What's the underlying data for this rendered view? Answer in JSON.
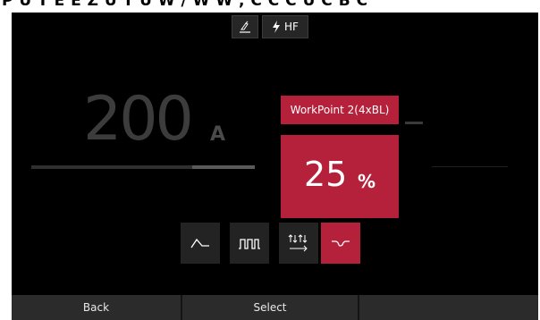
{
  "banner": {
    "text": "P U T E   E  Z U T U   W / W W ,  C C C  U C B C"
  },
  "mode_bar": {
    "torch_icon": "torch-icon",
    "lightning_icon": "lightning-icon",
    "hf_label": "HF"
  },
  "current": {
    "value": "200",
    "unit": "A"
  },
  "workpoint": {
    "title": "WorkPoint 2(4xBL)",
    "value": "25",
    "unit": "%"
  },
  "waveforms": [
    {
      "icon": "ramp-wave-icon",
      "selected": false
    },
    {
      "icon": "pulse-wave-icon",
      "selected": false
    },
    {
      "icon": "polarity-arrows-icon",
      "selected": false
    },
    {
      "icon": "ac-wave-icon",
      "selected": true
    }
  ],
  "footer": {
    "back": "Back",
    "select": "Select",
    "third": ""
  },
  "colors": {
    "accent": "#b5213a",
    "background": "#000000",
    "panel": "#232323"
  }
}
